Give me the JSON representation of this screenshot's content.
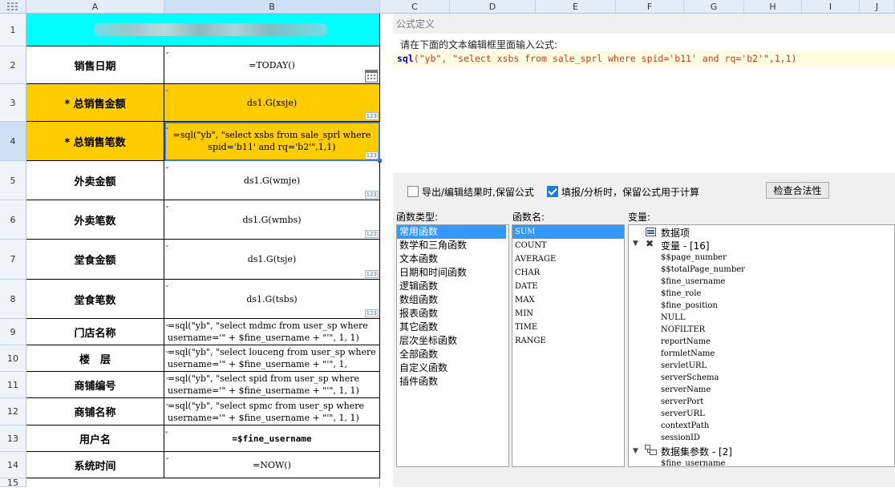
{
  "columns": [
    "A",
    "B",
    "C",
    "D",
    "E",
    "F",
    "G",
    "H",
    "I",
    "J"
  ],
  "rows": [
    "1",
    "2",
    "3",
    "4",
    "5",
    "6",
    "7",
    "8",
    "9",
    "10",
    "11",
    "12",
    "13",
    "14",
    "15"
  ],
  "sheet": {
    "labels": [
      "销售日期",
      "* 总销售金额",
      "* 总销售笔数",
      "外卖金额",
      "外卖笔数",
      "堂食金额",
      "堂食笔数",
      "门店名称",
      "楼　层",
      "商铺编号",
      "商铺名称",
      "用户名",
      "系统时间"
    ],
    "values": [
      "=TODAY()",
      "ds1.G(xsje)",
      "=sql(\"yb\", \"select xsbs from sale_sprl where spid='b11' and rq='b2'\",1,1)",
      "ds1.G(wmje)",
      "ds1.G(wmbs)",
      "ds1.G(tsje)",
      "ds1.G(tsbs)",
      "=sql(\"yb\", \"select mdmc from user_sp where username='\" + $fine_username + \"'\", 1, 1)",
      "=sql(\"yb\", \"select louceng from user_sp where username='\" + $fine_username + \"'\", 1,",
      "=sql(\"yb\", \"select spid from user_sp where username='\" + $fine_username + \"'\", 1, 1)",
      "=sql(\"yb\", \"select spmc from user_sp where username='\" + $fine_username + \"'\", 1, 1)",
      "=$fine_username",
      "=NOW()"
    ],
    "badge": "123"
  },
  "dialog": {
    "title": "公式定义",
    "prompt": "请在下面的文本编辑框里面输入公式:",
    "formula": {
      "keyword": "sql",
      "args": "(\"yb\", \"select xsbs from sale_sprl where spid='b11' and rq='b2'\",1,1)"
    },
    "opt1_label": "导出/编辑结果时,保留公式",
    "opt1_checked": "false",
    "opt2_label": "填报/分析时，保留公式用于计算",
    "opt2_checked": "true",
    "check_button": "检查合法性",
    "func_type_label": "函数类型:",
    "func_name_label": "函数名:",
    "var_label": "变量:",
    "func_types": [
      "常用函数",
      "数学和三角函数",
      "文本函数",
      "日期和时间函数",
      "逻辑函数",
      "数组函数",
      "报表函数",
      "其它函数",
      "层次坐标函数",
      "全部函数",
      "自定义函数",
      "插件函数"
    ],
    "func_names": [
      "SUM",
      "COUNT",
      "AVERAGE",
      "CHAR",
      "DATE",
      "MAX",
      "MIN",
      "TIME",
      "RANGE"
    ],
    "var_tree": {
      "data_items": "数据项",
      "variables_group": "变量 - [16]",
      "variables": [
        "$$page_number",
        "$$totalPage_number",
        "$fine_username",
        "$fine_role",
        "$fine_position",
        "NULL",
        "NOFILTER",
        "reportName",
        "formletName",
        "servletURL",
        "serverSchema",
        "serverName",
        "serverPort",
        "serverURL",
        "contextPath",
        "sessionID"
      ],
      "dataset_params": "数据集参数 - [2]",
      "dataset_children": [
        "$fine_username"
      ]
    }
  },
  "colors": {
    "gold": "#ffcc00",
    "cyan": "#00ffff",
    "selection": "#3399ff",
    "keyword": "#0000cc",
    "string": "#c0392b"
  }
}
